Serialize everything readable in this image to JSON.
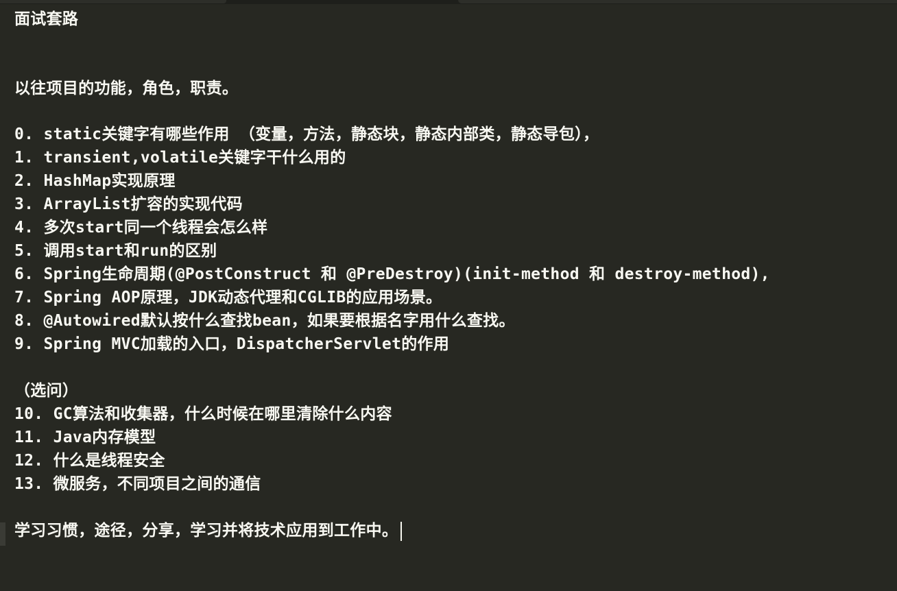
{
  "document": {
    "title": "面试套路",
    "intro": "以往项目的功能，角色，职责。",
    "questions": [
      "0. static关键字有哪些作用 （变量，方法，静态块，静态内部类，静态导包），",
      "1. transient,volatile关键字干什么用的",
      "2. HashMap实现原理",
      "3. ArrayList扩容的实现代码",
      "4. 多次start同一个线程会怎么样",
      "5. 调用start和run的区别",
      "6. Spring生命周期(@PostConstruct 和 @PreDestroy)(init-method 和 destroy-method),",
      "7. Spring AOP原理，JDK动态代理和CGLIB的应用场景。",
      "8. @Autowired默认按什么查找bean，如果要根据名字用什么查找。",
      "9. Spring MVC加载的入口，DispatcherServlet的作用"
    ],
    "optional_heading": "（选问）",
    "optional_questions": [
      "10. GC算法和收集器，什么时候在哪里清除什么内容",
      "11. Java内存模型",
      "12. 什么是线程安全",
      "13. 微服务，不同项目之间的通信"
    ],
    "closing": "学习习惯，途径，分享，学习并将技术应用到工作中。"
  },
  "colors": {
    "background": "#272822",
    "text": "#f8f8f2"
  }
}
